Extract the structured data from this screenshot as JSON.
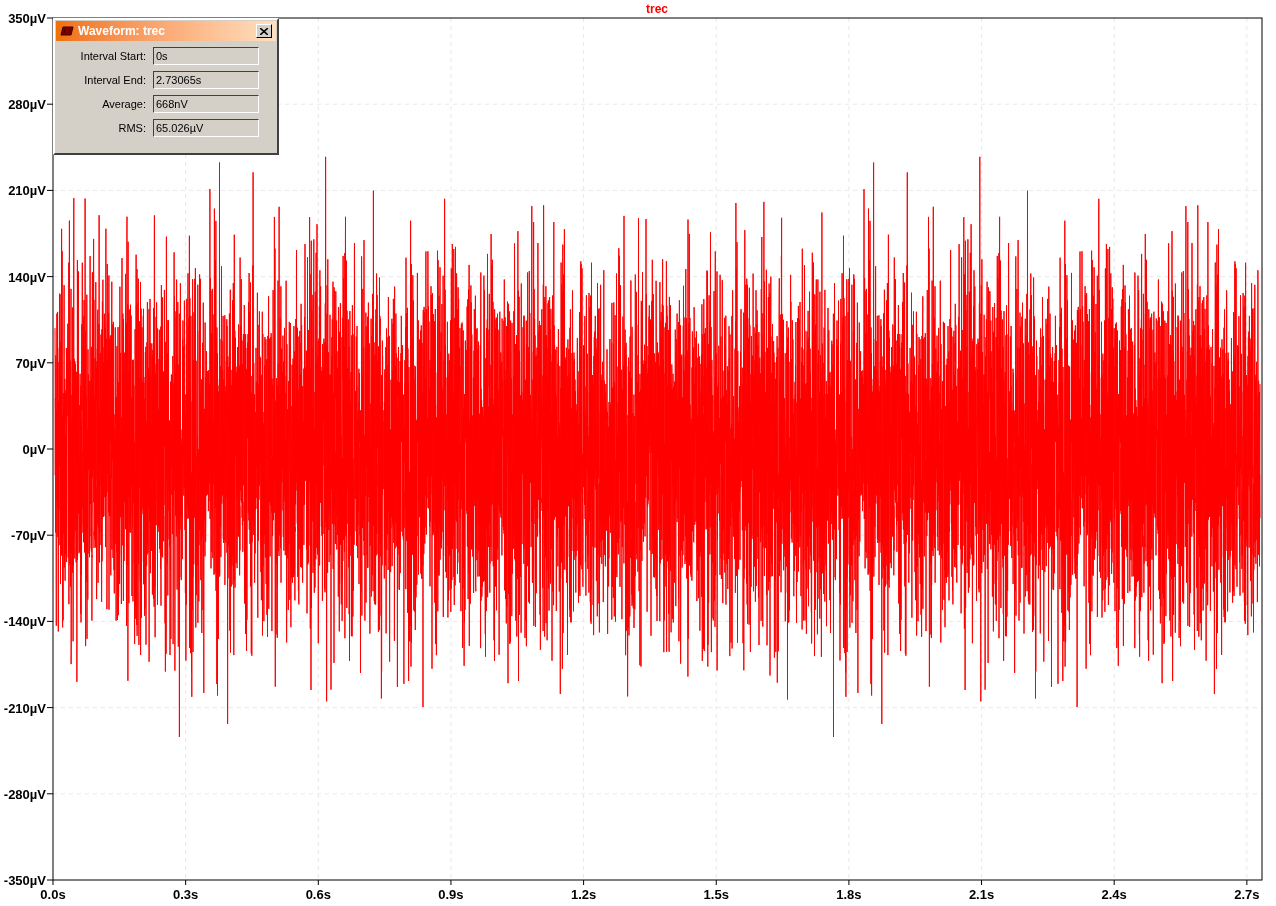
{
  "plot": {
    "title": "trec",
    "y_ticks": [
      "350µV",
      "280µV",
      "210µV",
      "140µV",
      "70µV",
      "0µV",
      "-70µV",
      "-140µV",
      "-210µV",
      "-280µV",
      "-350µV"
    ],
    "x_ticks": [
      "0.0s",
      "0.3s",
      "0.6s",
      "0.9s",
      "1.2s",
      "1.5s",
      "1.8s",
      "2.1s",
      "2.4s",
      "2.7s"
    ]
  },
  "dialog": {
    "title": "Waveform: trec",
    "fields": [
      {
        "label": "Interval Start:",
        "value": "0s"
      },
      {
        "label": "Interval End:",
        "value": "2.73065s"
      },
      {
        "label": "Average:",
        "value": "668nV"
      },
      {
        "label": "RMS:",
        "value": "65.026µV"
      }
    ]
  }
}
